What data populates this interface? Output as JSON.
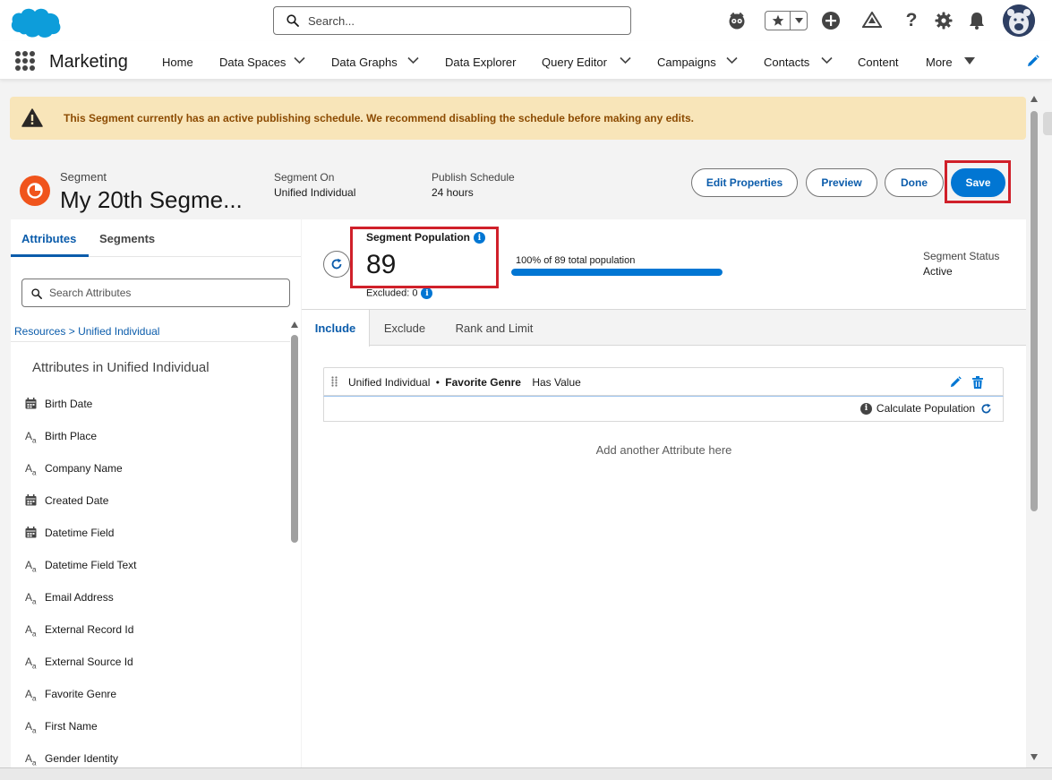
{
  "search": {
    "placeholder": "Search..."
  },
  "header_icons": [
    "einstein-icon",
    "favorites-star-icon",
    "favorites-dropdown-icon",
    "global-add-icon",
    "trailhead-icon",
    "help-icon",
    "setup-gear-icon",
    "notifications-bell-icon",
    "user-avatar"
  ],
  "nav": {
    "app_name": "Marketing",
    "items": [
      {
        "label": "Home"
      },
      {
        "label": "Data Spaces"
      },
      {
        "label": "Data Graphs"
      },
      {
        "label": "Data Explorer"
      },
      {
        "label": "Query Editor"
      },
      {
        "label": "Campaigns"
      },
      {
        "label": "Contacts"
      },
      {
        "label": "Content"
      },
      {
        "label": "More"
      }
    ]
  },
  "banner": {
    "text": "This Segment currently has an active publishing schedule. We recommend disabling the schedule before making any edits."
  },
  "record": {
    "type": "Segment",
    "title": "My 20th Segme...",
    "segment_on_label": "Segment On",
    "segment_on_value": "Unified Individual",
    "publish_schedule_label": "Publish Schedule",
    "publish_schedule_value": "24 hours",
    "buttons": {
      "edit": "Edit Properties",
      "preview": "Preview",
      "done": "Done",
      "save": "Save"
    }
  },
  "left": {
    "tabs": [
      "Attributes",
      "Segments"
    ],
    "search_placeholder": "Search Attributes",
    "breadcrumb": {
      "root": "Resources",
      "sep": ">",
      "current": "Unified Individual"
    },
    "heading": "Attributes in Unified Individual",
    "attributes": [
      {
        "label": "Birth Date",
        "type": "date"
      },
      {
        "label": "Birth Place",
        "type": "text"
      },
      {
        "label": "Company Name",
        "type": "text"
      },
      {
        "label": "Created Date",
        "type": "date"
      },
      {
        "label": "Datetime Field",
        "type": "date"
      },
      {
        "label": "Datetime Field Text",
        "type": "text"
      },
      {
        "label": "Email Address",
        "type": "text"
      },
      {
        "label": "External Record Id",
        "type": "text"
      },
      {
        "label": "External Source Id",
        "type": "text"
      },
      {
        "label": "Favorite Genre",
        "type": "text"
      },
      {
        "label": "First Name",
        "type": "text"
      },
      {
        "label": "Gender Identity",
        "type": "text"
      }
    ]
  },
  "main": {
    "population_label": "Segment Population",
    "population_value": "89",
    "excluded": "Excluded: 0",
    "progress_label": "100% of 89 total population",
    "progress_fraction": 1.0,
    "status_label": "Segment Status",
    "status_value": "Active",
    "tabs": [
      "Include",
      "Exclude",
      "Rank and Limit"
    ],
    "criteria": {
      "object": "Unified Individual",
      "bullet": "•",
      "attribute": "Favorite Genre",
      "operator": "Has Value"
    },
    "calculate": "Calculate Population",
    "add_attribute": "Add another Attribute here"
  },
  "colors": {
    "brand_blue": "#0176d3",
    "link_blue": "#0b5cab",
    "warning_bg": "#f8e5b9",
    "highlight_red": "#d0202a",
    "segment_icon": "#f0541c"
  }
}
